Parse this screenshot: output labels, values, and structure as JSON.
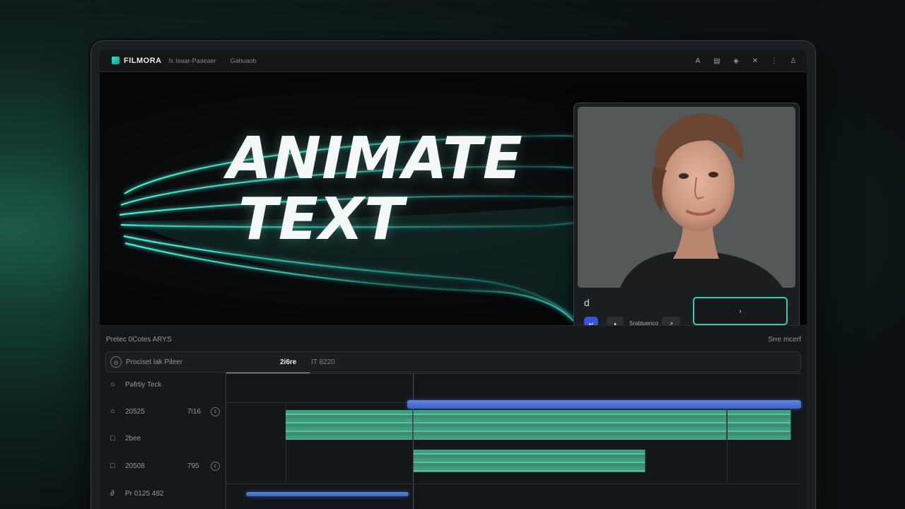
{
  "app": {
    "brand": "FILMORA",
    "menu": [
      "fx Iəəar-Paəeaer",
      "Gəbuaob"
    ],
    "top_icons": [
      "text-icon",
      "layout-icon",
      "shield-icon",
      "close-icon",
      "more-icon",
      "user-icon"
    ]
  },
  "preview": {
    "headline_line1": "ANIMATE",
    "headline_line2": "TEXT"
  },
  "viewer": {
    "glyph": "d",
    "accent_button": "↩",
    "small_button": "♦",
    "label": "Srabtuenco",
    "small_button2": "↗",
    "big_button": "›"
  },
  "panel": {
    "title": "Pretec 0Cotes ARYS",
    "right_label": "Srre mcer",
    "right_accent": "f",
    "search_text": "Prociset lak Pileer",
    "time_current": "2i6re",
    "time_total": "IT 8220",
    "tracks": [
      {
        "icon": "○",
        "name": "Pəfrtiy Teck",
        "value": "",
        "circle": ""
      },
      {
        "icon": "○",
        "name": "20525",
        "value": "7i16",
        "circle": "c"
      },
      {
        "icon": "□",
        "name": "2bee",
        "value": "",
        "circle": ""
      },
      {
        "icon": "□",
        "name": "20508",
        "value": "795",
        "circle": "c"
      },
      {
        "icon": "∂",
        "name": "Pr 0125 482",
        "value": "",
        "circle": ""
      }
    ]
  },
  "colors": {
    "accent_teal": "#3fc9b5",
    "clip_blue": "#4a72d4",
    "clip_green": "#4aa88a"
  }
}
